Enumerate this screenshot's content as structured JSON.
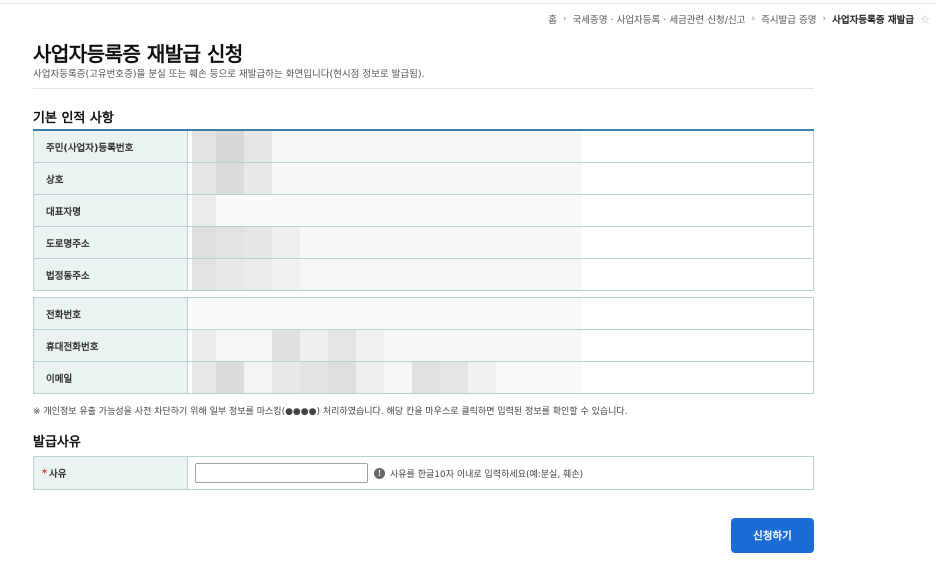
{
  "breadcrumb": {
    "items": [
      "홈",
      "국세증명 · 사업자등록 · 세금관련 신청/신고",
      "즉시발급 증명"
    ],
    "current": "사업자등록증 재발급",
    "separator": "›",
    "star_icon": "star-outline-icon"
  },
  "page": {
    "title": "사업자등록증 재발급 신청",
    "description": "사업자등록증(고유번호증)을 분실 또는 훼손 등으로 재발급하는 화면입니다(현시점 정보로 발급됨)."
  },
  "basic_info": {
    "title": "기본 인적 사항",
    "rows_group1": [
      {
        "label": "주민(사업자)등록번호",
        "value_masked": true
      },
      {
        "label": "상호",
        "value_masked": true
      },
      {
        "label": "대표자명",
        "value_masked": true
      },
      {
        "label": "도로명주소",
        "value_masked": true
      },
      {
        "label": "법정동주소",
        "value_masked": true
      }
    ],
    "rows_group2": [
      {
        "label": "전화번호",
        "value_masked": true
      },
      {
        "label": "휴대전화번호",
        "value_masked": true
      },
      {
        "label": "이메일",
        "value_masked": true
      }
    ],
    "note": "※ 개인정보 유출 가능성을 사전 차단하기 위해 일부 정보를 마스킹(●●●●) 처리하였습니다. 해당 칸을 마우스로 클릭하면 입력된 정보를 확인할 수 있습니다."
  },
  "reason": {
    "title": "발급사유",
    "required_mark": "*",
    "label": "사유",
    "input_value": "",
    "input_placeholder": "",
    "hint": "사유를 한글10자 이내로 입력하세요(예:분실, 훼손)",
    "hint_icon": "info-circle-icon"
  },
  "actions": {
    "submit_label": "신청하기"
  },
  "colors": {
    "accent_button": "#1a6bd4",
    "label_bg": "#eaf3f1",
    "border": "#b7d0d0",
    "required": "#d92b2b"
  }
}
